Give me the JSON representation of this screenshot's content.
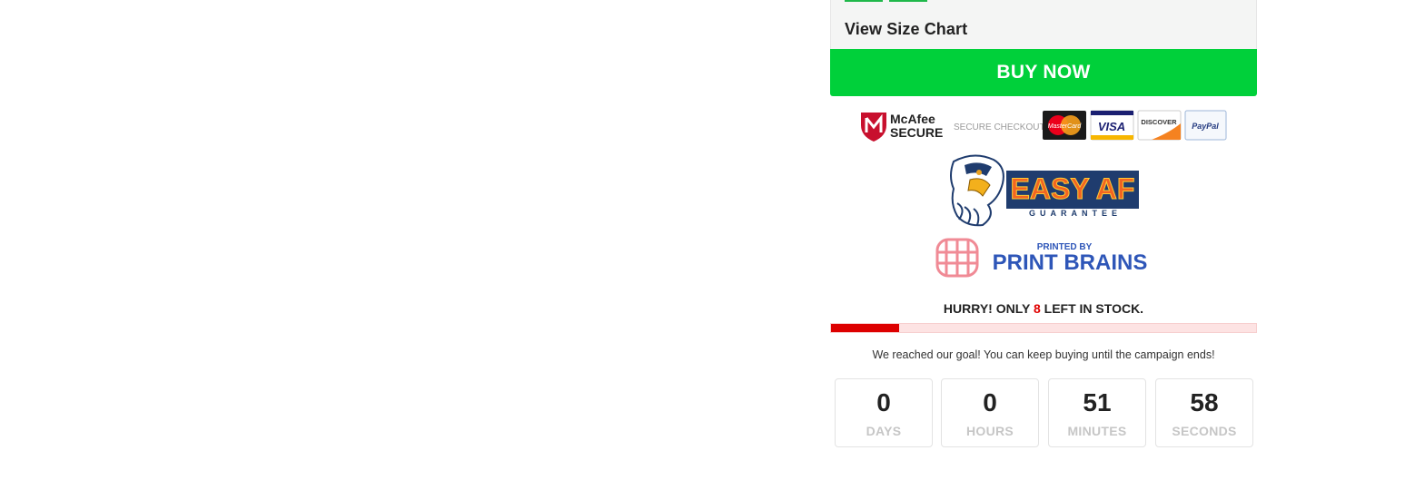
{
  "product": {
    "size_chart_label": "View Size Chart",
    "buy_button_label": "BUY NOW"
  },
  "trust_badges": {
    "mcafee_line1": "McAfee",
    "mcafee_line2": "SECURE",
    "secure_checkout": "SECURE CHECKOUT:",
    "cards": [
      "MasterCard",
      "VISA",
      "DISCOVER",
      "PayPal"
    ]
  },
  "guarantee": {
    "title": "EASY AF",
    "subtitle": "GUARANTEE"
  },
  "printer": {
    "printed_by": "PRINTED BY",
    "name": "PRINT BRAINS"
  },
  "stock": {
    "prefix": "HURRY! ONLY",
    "count": "8",
    "suffix": "LEFT IN STOCK.",
    "remaining_fraction": 0.16
  },
  "campaign": {
    "goal_message": "We reached our goal! You can keep buying until the campaign ends!"
  },
  "countdown": [
    {
      "value": "0",
      "label": "DAYS"
    },
    {
      "value": "0",
      "label": "HOURS"
    },
    {
      "value": "51",
      "label": "MINUTES"
    },
    {
      "value": "58",
      "label": "SECONDS"
    }
  ],
  "colors": {
    "buy_button": "#00d03a",
    "stock_bar": "#dd0000",
    "stock_bar_bg": "#fde3e3",
    "mcafee_red": "#c8102e",
    "printbrains_blue": "#2e56b8",
    "printbrains_pink": "#f08a95"
  }
}
